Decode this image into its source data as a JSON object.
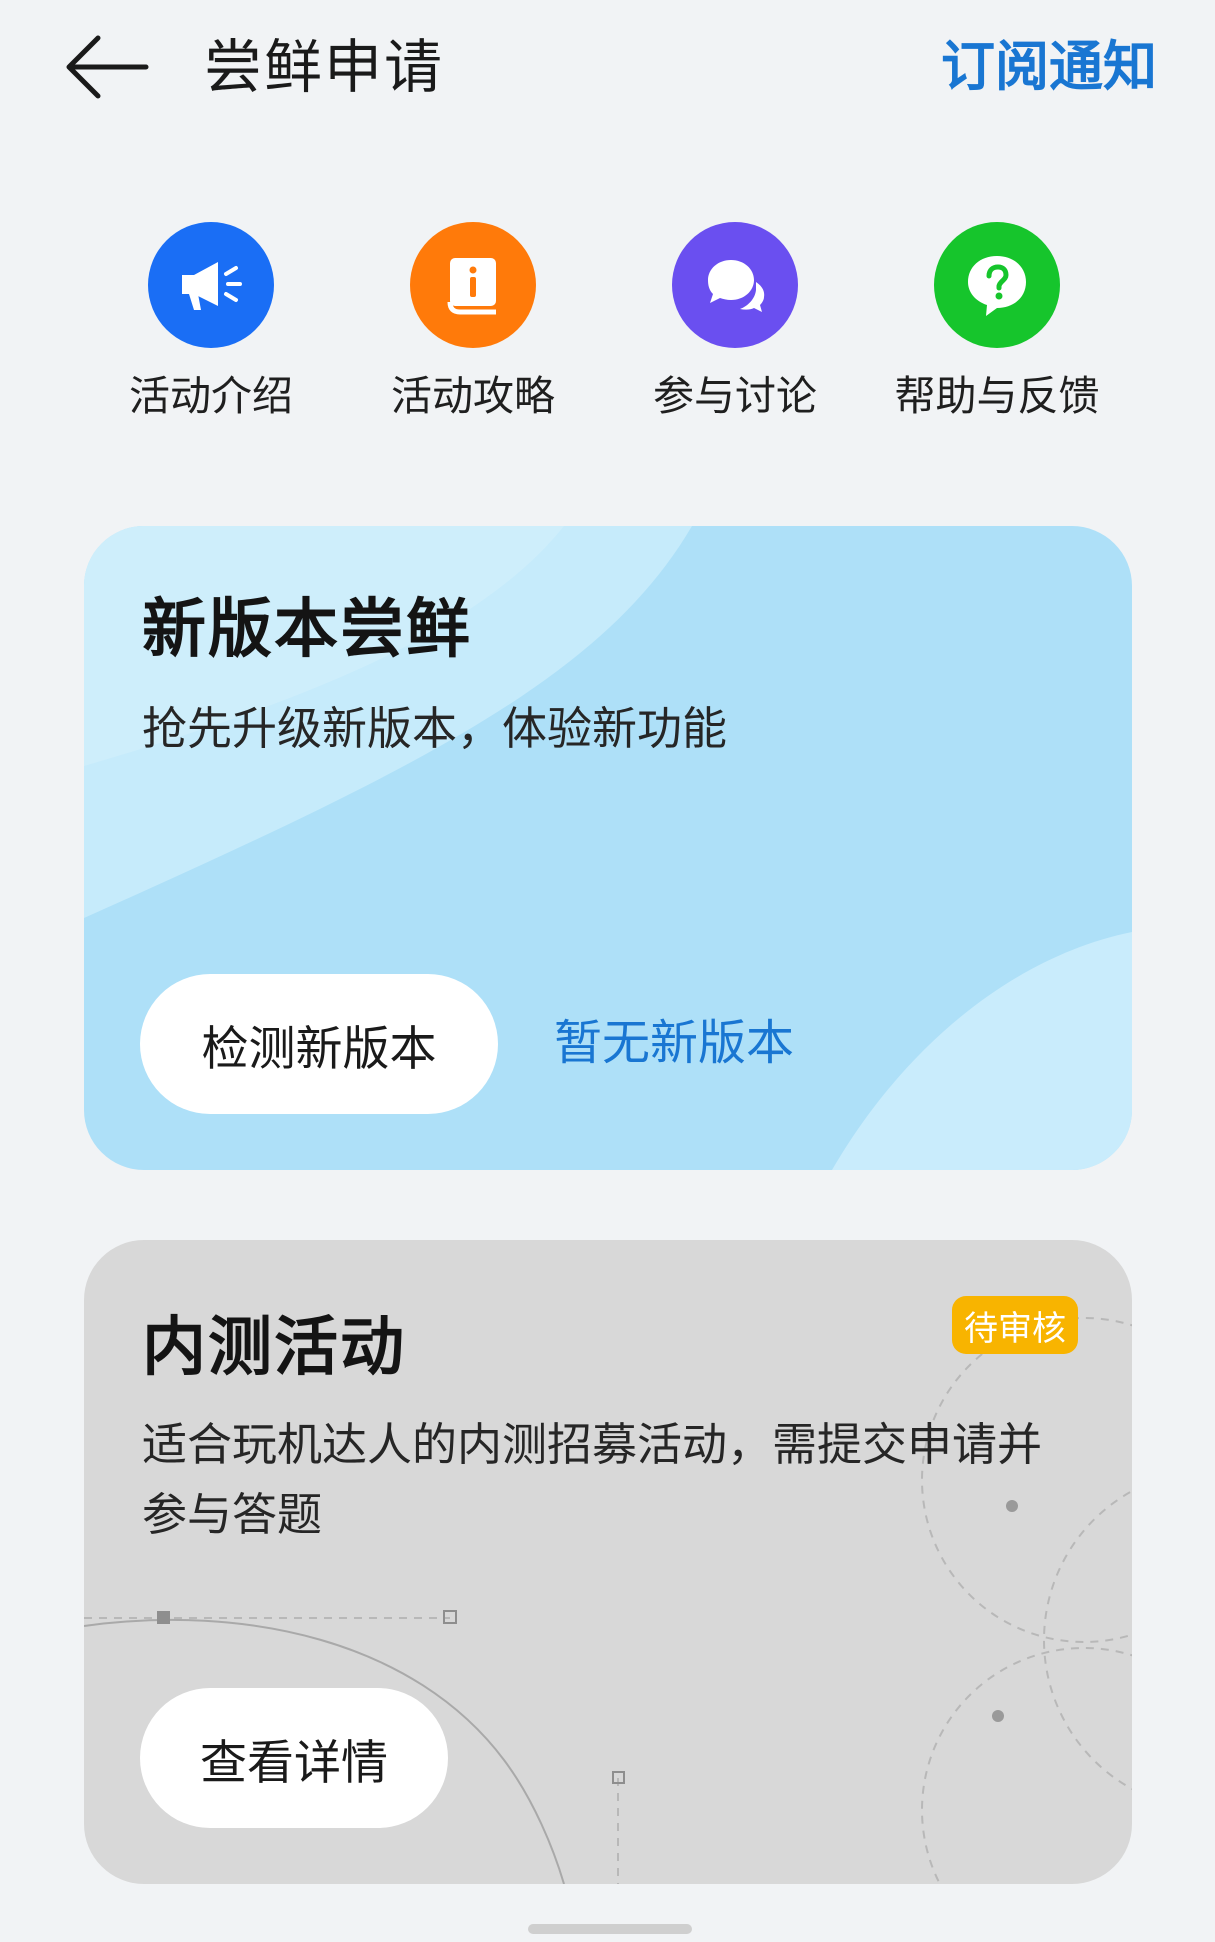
{
  "header": {
    "title": "尝鲜申请",
    "subscribe_label": "订阅通知",
    "back_icon": "arrow-left-icon"
  },
  "quick_nav": [
    {
      "label": "活动介绍",
      "icon": "megaphone-icon",
      "color": "#1a6ef5"
    },
    {
      "label": "活动攻略",
      "icon": "guide-book-icon",
      "color": "#ff7a0a"
    },
    {
      "label": "参与讨论",
      "icon": "chat-bubbles-icon",
      "color": "#6a4ff0"
    },
    {
      "label": "帮助与反馈",
      "icon": "question-bubble-icon",
      "color": "#16c52c"
    }
  ],
  "update_card": {
    "title": "新版本尝鲜",
    "description": "抢先升级新版本，体验新功能",
    "button_label": "检测新版本",
    "status_text": "暂无新版本",
    "background": "#aee0f8"
  },
  "beta_card": {
    "title": "内测活动",
    "badge": "待审核",
    "badge_color": "#f8b400",
    "description": "适合玩机达人的内测招募活动，需提交申请并参与答题",
    "button_label": "查看详情",
    "background": "#d8d8d8"
  },
  "colors": {
    "accent": "#1976d2",
    "page_background": "#f1f3f5"
  }
}
